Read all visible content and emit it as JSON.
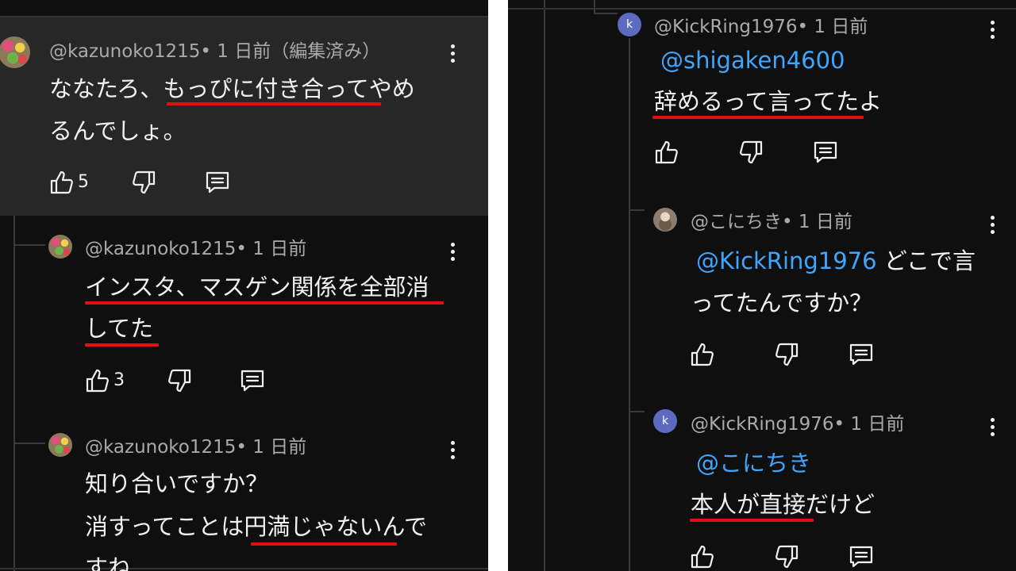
{
  "left": {
    "comments": [
      {
        "author": "@kazunoko1215",
        "meta": "• 1 日前（編集済み）",
        "lines": [
          "ななたろ、もっぴに付き合ってやめ",
          "るんでしょ。"
        ],
        "likes": "5"
      },
      {
        "author": "@kazunoko1215",
        "meta": "• 1 日前",
        "lines": [
          "インスタ、マスゲン関係を全部消",
          "してた"
        ],
        "likes": "3"
      },
      {
        "author": "@kazunoko1215",
        "meta": "• 1 日前",
        "lines": [
          "知り合いですか？",
          "消すってことは円満じゃないんで",
          "すね"
        ]
      }
    ]
  },
  "right": {
    "comments": [
      {
        "author": "@KickRing1976",
        "meta": "• 1 日前",
        "avatar_letter": "k",
        "mention": "@shigaken4600",
        "lines": [
          "辞めるって言ってたよ"
        ]
      },
      {
        "author": "@こにちき",
        "meta": "• 1 日前",
        "mention": "@KickRing1976",
        "inline": " どこで言",
        "lines": [
          "ってたんですか？"
        ]
      },
      {
        "author": "@KickRing1976",
        "meta": "• 1 日前",
        "avatar_letter": "k",
        "mention": "@こにちき",
        "lines": [
          "本人が直接だけど"
        ]
      }
    ]
  },
  "icons": [
    "thumbs-up-icon",
    "thumbs-down-icon",
    "reply-icon",
    "more-vert-icon"
  ],
  "colors": {
    "background": "#0f0f0f",
    "highlight": "#272727",
    "mention": "#3ea6ff",
    "underline": "#e01010",
    "text": "#f1f1f1",
    "meta": "#aaaaaa"
  }
}
